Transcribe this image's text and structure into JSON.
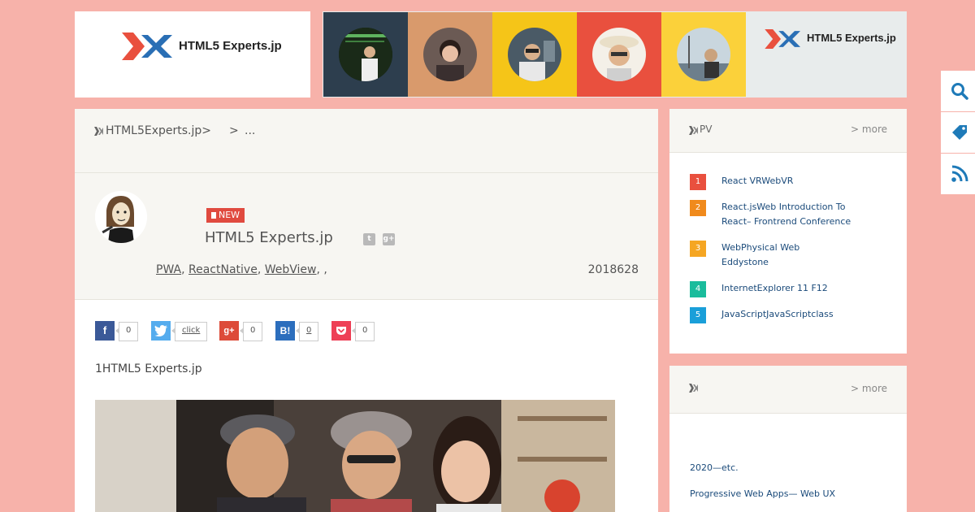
{
  "header": {
    "logo_text": "HTML5 Experts.jp",
    "banner_logo_text": "HTML5 Experts.jp",
    "tile_colors": [
      "#2d3e4e",
      "#d99a6c",
      "#f5c518",
      "#e9503e",
      "#fbd13a"
    ]
  },
  "breadcrumb": {
    "home": "HTML5Experts.jp>",
    "sep": ">",
    "current": "..."
  },
  "article": {
    "badge": "NEW",
    "author": "HTML5 Experts.jp",
    "tags": [
      "PWA",
      "ReactNative",
      "WebView"
    ],
    "tag_sep": ",",
    "tags_tail": ", ,",
    "date": "2018628",
    "lead": "1HTML5 Experts.jp"
  },
  "share": {
    "facebook": {
      "icon": "f",
      "count": "0",
      "color": "#3b5998"
    },
    "twitter": {
      "count": "click",
      "color": "#55acee"
    },
    "googleplus": {
      "icon": "g+",
      "count": "0",
      "color": "#dd4b39"
    },
    "hatena": {
      "icon": "B!",
      "count": "0",
      "color": "#2c6ebd"
    },
    "pocket": {
      "count": "0",
      "color": "#ee4056"
    }
  },
  "ranking": {
    "title": "PV",
    "more": "> more",
    "items": [
      {
        "num": "1",
        "text": "React VRWebVR",
        "color": "#e9503e"
      },
      {
        "num": "2",
        "text": "React.jsWeb Introduction To React– Frontrend Conference",
        "color": "#f08a1c"
      },
      {
        "num": "3",
        "text": "WebPhysical Web Eddystone",
        "color": "#f5a623"
      },
      {
        "num": "4",
        "text": "InternetExplorer 11 F12",
        "color": "#1abc9c"
      },
      {
        "num": "5",
        "text": "JavaScriptJavaScriptclass",
        "color": "#1a9fd9"
      }
    ]
  },
  "second_card": {
    "title": "",
    "more": "> more",
    "links": [
      "2020—etc.",
      "Progressive Web Apps— Web UX"
    ]
  },
  "side_tabs": [
    "search-icon",
    "tag-icon",
    "rss-icon"
  ]
}
